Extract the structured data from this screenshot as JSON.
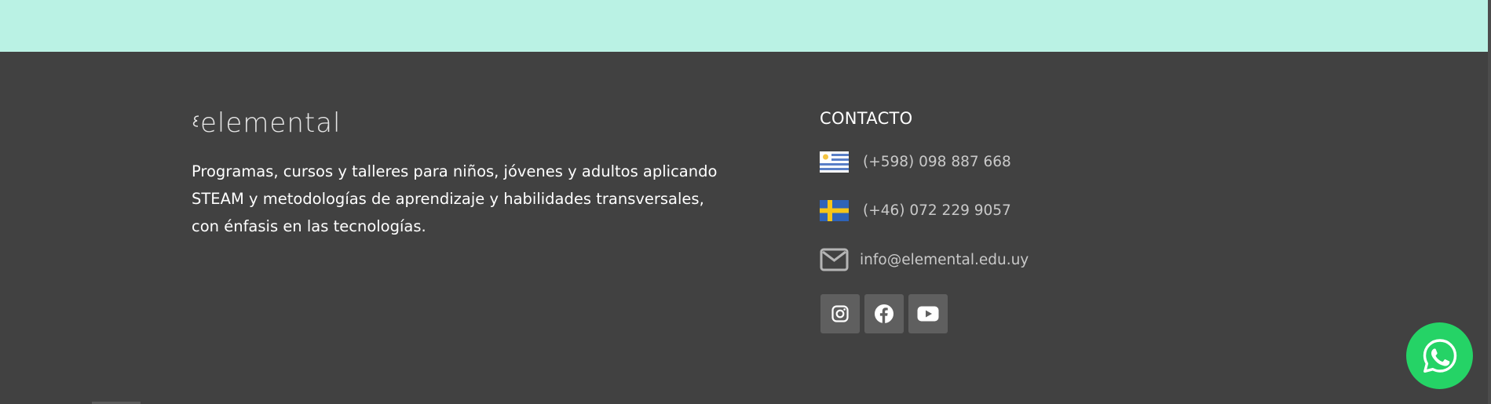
{
  "brand": {
    "logo_text": "elemental"
  },
  "about": {
    "text": "Programas, cursos y talleres para niños, jóvenes y adultos aplicando STEAM y metodologías de aprendizaje y habilidades transversales, con énfasis en las tecnologías."
  },
  "contact": {
    "title": "CONTACTO",
    "phone_uy": "(+598) 098 887 668",
    "phone_se": "(+46) 072 229 9057",
    "email": "info@elemental.edu.uy"
  },
  "social": [
    {
      "icon": "instagram-icon"
    },
    {
      "icon": "facebook-icon"
    },
    {
      "icon": "youtube-icon"
    }
  ],
  "colors": {
    "top_band": "#baf2e4",
    "footer_bg": "#414141",
    "social_bg": "#5f5f5f",
    "whatsapp": "#25d366"
  }
}
